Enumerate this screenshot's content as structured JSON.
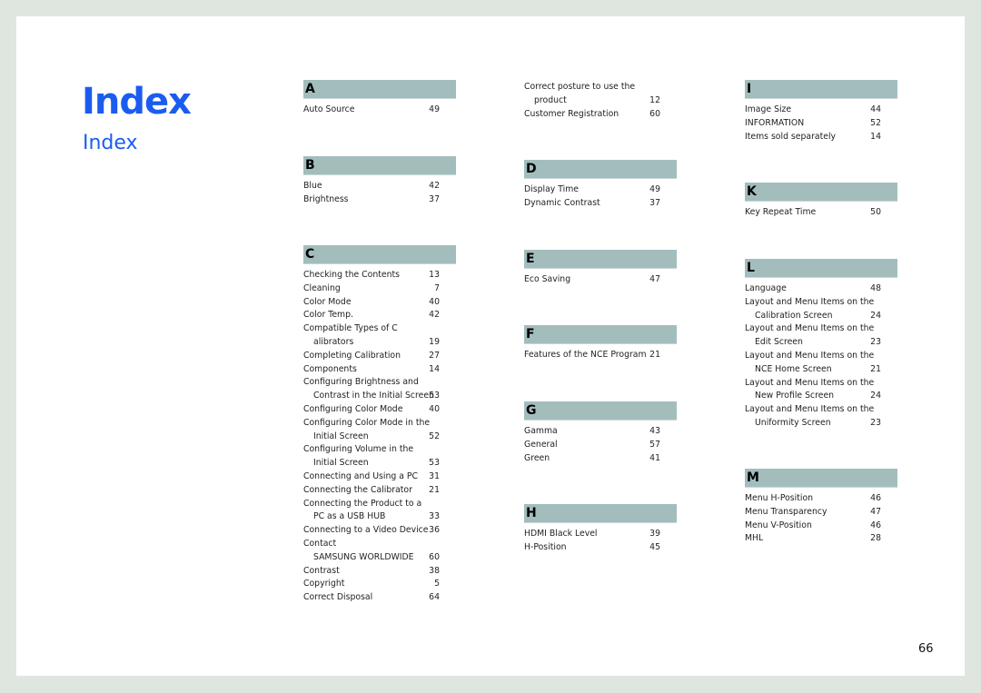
{
  "title": "Index",
  "subtitle": "Index",
  "page_number": "66",
  "columns": [
    {
      "sections": [
        {
          "letter": "A",
          "entries": [
            {
              "text": "Auto Source",
              "page": "49"
            }
          ]
        },
        {
          "letter": "B",
          "entries": [
            {
              "text": "Blue",
              "page": "42"
            },
            {
              "text": "Brightness",
              "page": "37"
            }
          ]
        },
        {
          "letter": "C",
          "entries": [
            {
              "text": "Checking the Contents",
              "page": "13"
            },
            {
              "text": "Cleaning",
              "page": "7"
            },
            {
              "text": "Color Mode",
              "page": "40"
            },
            {
              "text": "Color Temp.",
              "page": "42"
            },
            {
              "text": "Compatible Types of C",
              "cont": "alibrators",
              "page": "19"
            },
            {
              "text": "Completing Calibration",
              "page": "27"
            },
            {
              "text": "Components",
              "page": "14"
            },
            {
              "text": "Configuring Brightness and",
              "cont": "Contrast in the Initial Screen",
              "page": "53"
            },
            {
              "text": "Configuring Color Mode",
              "page": "40"
            },
            {
              "text": "Configuring Color Mode in the",
              "cont": "Initial Screen",
              "page": "52"
            },
            {
              "text": "Configuring Volume in the",
              "cont": "Initial Screen",
              "page": "53"
            },
            {
              "text": "Connecting and Using a PC",
              "page": "31"
            },
            {
              "text": "Connecting the Calibrator",
              "page": "21"
            },
            {
              "text": "Connecting the Product to a",
              "cont": "PC as a USB HUB",
              "page": "33"
            },
            {
              "text": "Connecting to a Video Device",
              "page": "36"
            },
            {
              "text": "Contact",
              "cont": "SAMSUNG WORLDWIDE",
              "page": "60"
            },
            {
              "text": "Contrast",
              "page": "38"
            },
            {
              "text": "Copyright",
              "page": "5"
            },
            {
              "text": "Correct Disposal",
              "page": "64"
            }
          ]
        }
      ]
    },
    {
      "sections": [
        {
          "letter": "",
          "entries": [
            {
              "text": "Correct posture to use the",
              "cont": "product",
              "page": "12"
            },
            {
              "text": "Customer Registration",
              "page": "60"
            }
          ]
        },
        {
          "letter": "D",
          "entries": [
            {
              "text": "Display Time",
              "page": "49"
            },
            {
              "text": "Dynamic Contrast",
              "page": "37"
            }
          ]
        },
        {
          "letter": "E",
          "entries": [
            {
              "text": "Eco Saving",
              "page": "47"
            }
          ]
        },
        {
          "letter": "F",
          "entries": [
            {
              "text": "Features of the NCE Program",
              "page": "21"
            }
          ]
        },
        {
          "letter": "G",
          "entries": [
            {
              "text": "Gamma",
              "page": "43"
            },
            {
              "text": "General",
              "page": "57"
            },
            {
              "text": "Green",
              "page": "41"
            }
          ]
        },
        {
          "letter": "H",
          "entries": [
            {
              "text": "HDMI Black Level",
              "page": "39"
            },
            {
              "text": "H-Position",
              "page": "45"
            }
          ]
        }
      ]
    },
    {
      "sections": [
        {
          "letter": "I",
          "entries": [
            {
              "text": "Image Size",
              "page": "44"
            },
            {
              "text": "INFORMATION",
              "page": "52"
            },
            {
              "text": "Items sold separately",
              "page": "14"
            }
          ]
        },
        {
          "letter": "K",
          "entries": [
            {
              "text": "Key Repeat Time",
              "page": "50"
            }
          ]
        },
        {
          "letter": "L",
          "entries": [
            {
              "text": "Language",
              "page": "48"
            },
            {
              "text": "Layout and Menu Items on the",
              "cont": "Calibration Screen",
              "page": "24"
            },
            {
              "text": "Layout and Menu Items on the",
              "cont": "Edit Screen",
              "page": "23"
            },
            {
              "text": "Layout and Menu Items on the",
              "cont": "NCE Home Screen",
              "page": "21"
            },
            {
              "text": "Layout and Menu Items on the",
              "cont": "New Profile Screen",
              "page": "24"
            },
            {
              "text": "Layout and Menu Items on the",
              "cont": "Uniformity Screen",
              "page": "23"
            }
          ]
        },
        {
          "letter": "M",
          "entries": [
            {
              "text": "Menu H-Position",
              "page": "46"
            },
            {
              "text": "Menu Transparency",
              "page": "47"
            },
            {
              "text": "Menu V-Position",
              "page": "46"
            },
            {
              "text": "MHL",
              "page": "28"
            }
          ]
        }
      ]
    }
  ]
}
